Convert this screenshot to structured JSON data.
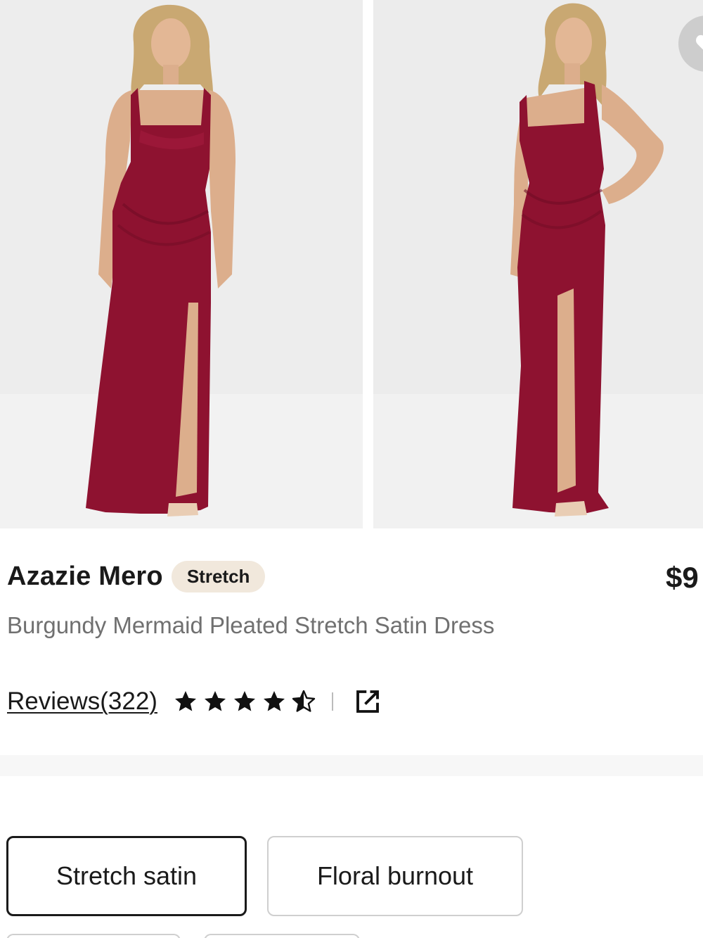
{
  "gallery": {
    "images": [
      {
        "name": "front-view"
      },
      {
        "name": "side-view"
      }
    ],
    "dress_color": "#8e1230",
    "background_color": "#ececec"
  },
  "product": {
    "brand": "Azazie Mero",
    "tag": "Stretch",
    "price": "$9",
    "title": "Burgundy Mermaid Pleated Stretch Satin Dress",
    "reviews_label": "Reviews(322)",
    "rating": 4.5
  },
  "fabric_options": [
    {
      "label": "Stretch satin",
      "selected": true
    },
    {
      "label": "Floral burnout",
      "selected": false
    }
  ],
  "icons": {
    "favorite": "heart-icon",
    "share": "share-external-icon",
    "star": "star-icon"
  }
}
